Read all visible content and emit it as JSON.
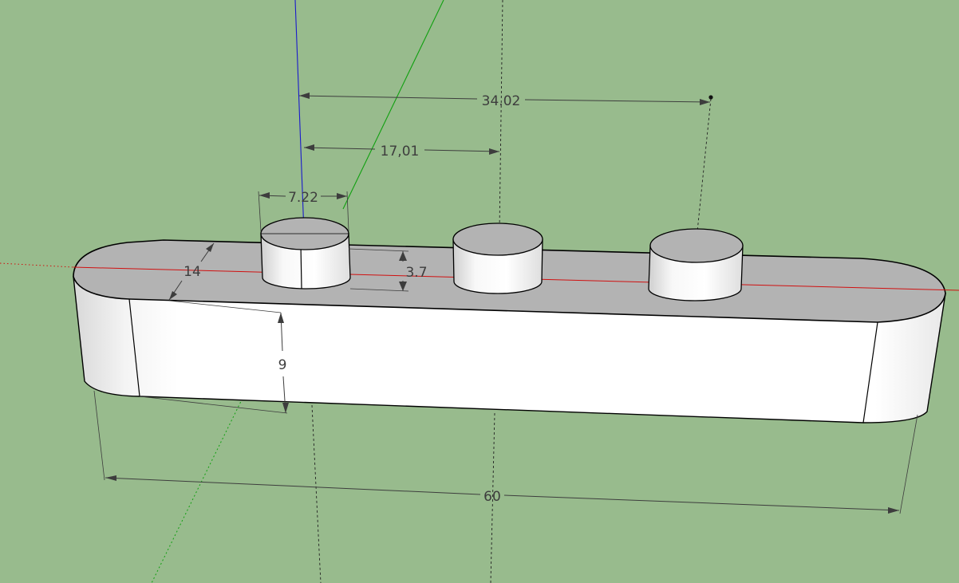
{
  "viewport": {
    "background_color": "#98bb8d",
    "model_face_color": "#ffffff",
    "model_top_color": "#b3b3b3",
    "axis_colors": {
      "x": "#d01010",
      "y": "#10a010",
      "z": "#1a1acc"
    }
  },
  "dimensions": {
    "overall_length": "60",
    "body_width": "14",
    "body_height": "9",
    "peg_diameter": "7.22",
    "peg_height": "3.7",
    "peg_spacing": "17,01",
    "peg_span": "34.02"
  }
}
